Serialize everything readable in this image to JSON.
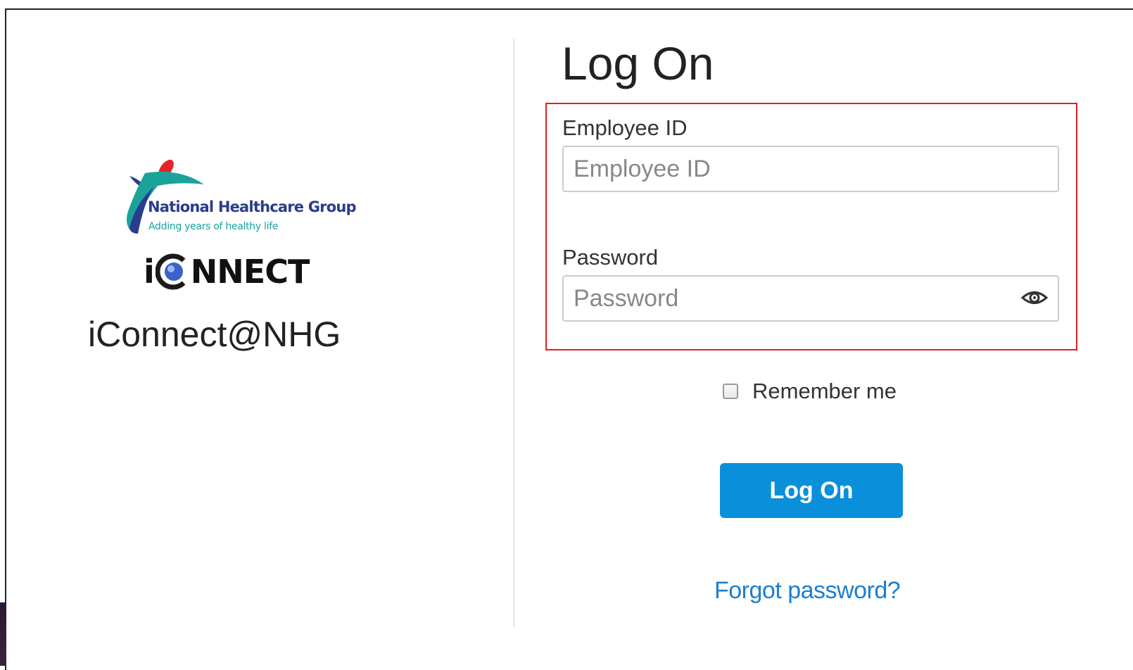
{
  "brand": {
    "org_name": "National Healthcare Group",
    "tagline": "Adding years of healthy life",
    "product_logo_text_prefix": "i",
    "product_logo_text_suffix": "NNECT",
    "app_title": "iConnect@NHG",
    "logo_colors": {
      "navy": "#2b3c8c",
      "teal": "#1aa39b",
      "red": "#e3242b"
    }
  },
  "form": {
    "title": "Log On",
    "employee_id": {
      "label": "Employee ID",
      "placeholder": "Employee ID",
      "value": ""
    },
    "password": {
      "label": "Password",
      "placeholder": "Password",
      "value": "",
      "toggle_icon": "eye-icon"
    },
    "remember_me": {
      "label": "Remember me",
      "checked": false
    },
    "submit_label": "Log On",
    "forgot_link": "Forgot password?"
  },
  "colors": {
    "primary_button": "#0a8fdb",
    "link": "#1a7fd0",
    "highlight_box": "#e02020"
  }
}
